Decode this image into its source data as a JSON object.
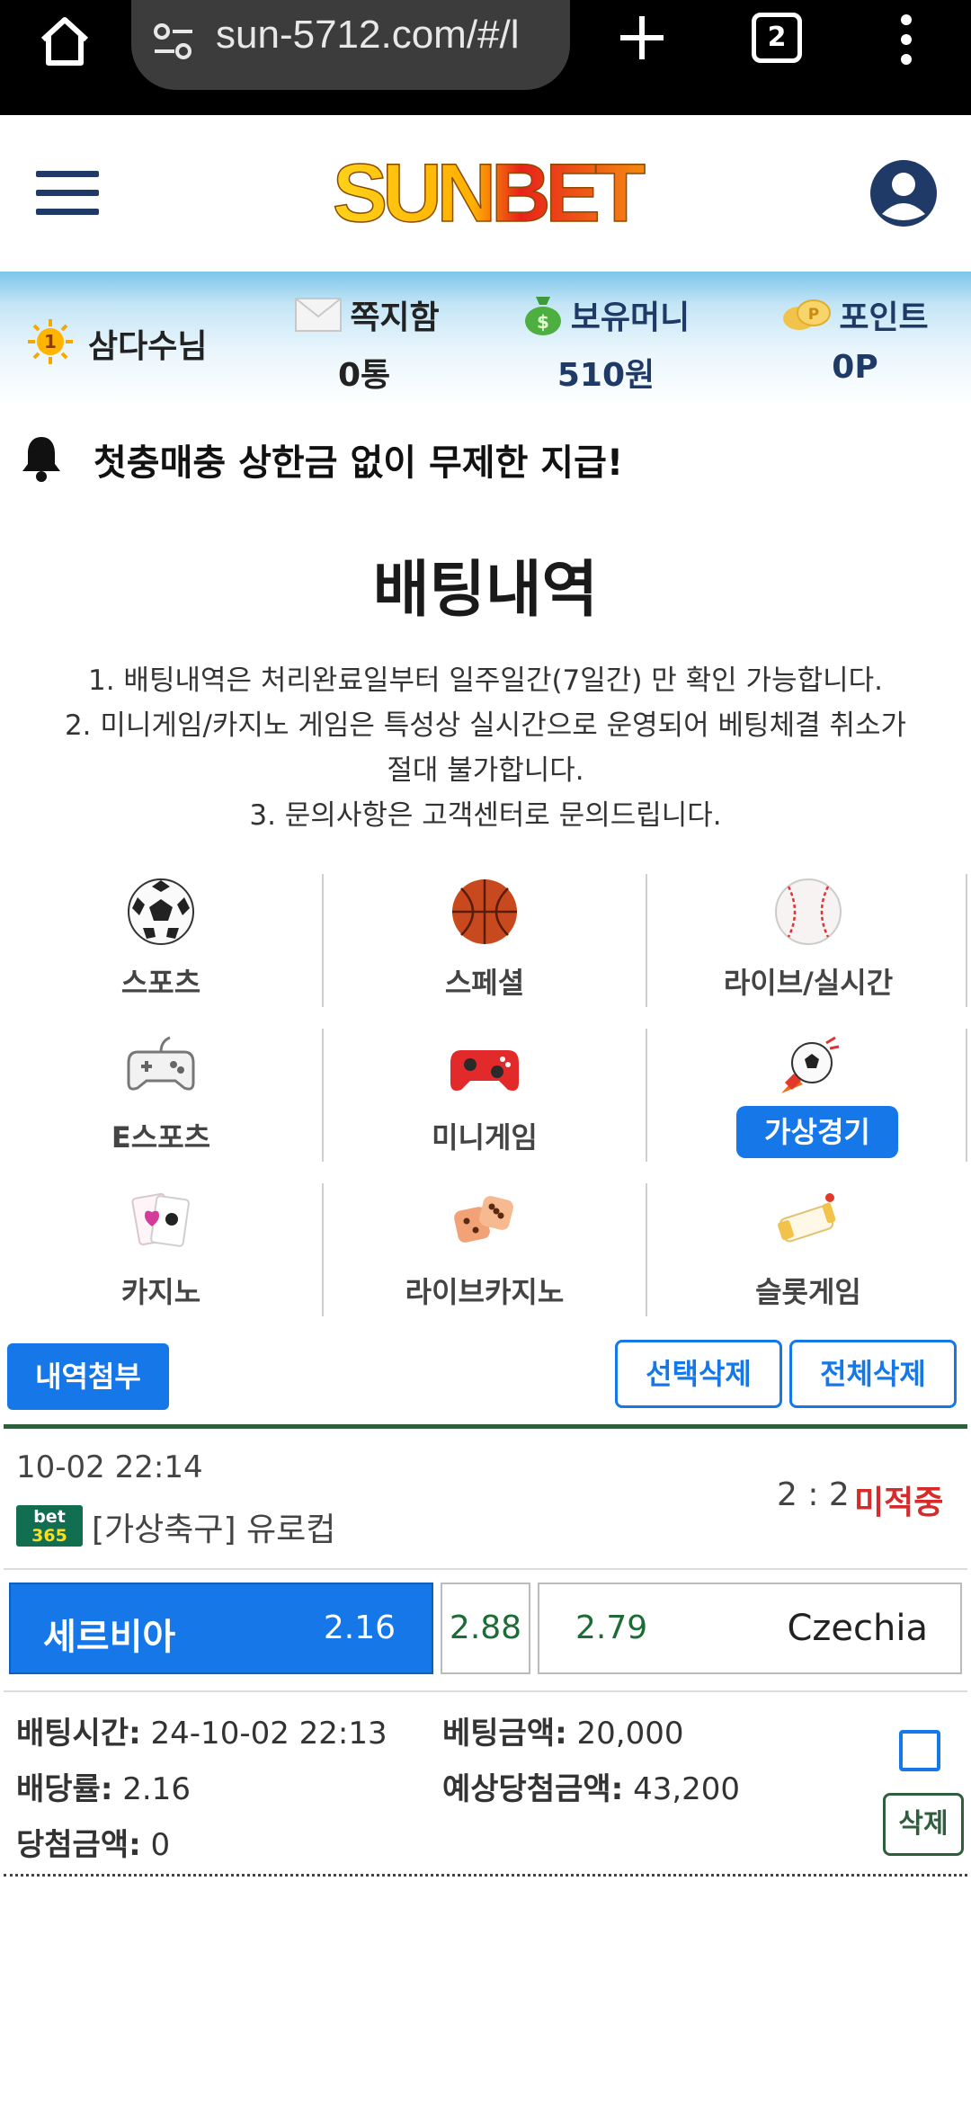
{
  "browser": {
    "url": "sun-5712.com/#/l",
    "tab_count": "2"
  },
  "header": {
    "logo_text": "SUNBET"
  },
  "member": {
    "nickname": "삼다수님",
    "message_label": "쪽지함",
    "message_value": "0통",
    "money_label": "보유머니",
    "money_value": "510원",
    "point_label": "포인트",
    "point_value": "0P"
  },
  "notice": {
    "text": "첫충매충 상한금 없이 무제한 지급!"
  },
  "page": {
    "title": "배팅내역",
    "rules": [
      "1. 배팅내역은 처리완료일부터 일주일간(7일간) 만 확인 가능합니다.",
      "2. 미니게임/카지노 게임은 특성상 실시간으로 운영되어 베팅체결 취소가",
      "절대 불가합니다.",
      "3. 문의사항은 고객센터로 문의드립니다."
    ]
  },
  "categories": [
    {
      "label": "스포츠",
      "icon": "soccer-ball-icon",
      "active": false
    },
    {
      "label": "스페셜",
      "icon": "basketball-icon",
      "active": false
    },
    {
      "label": "라이브/실시간",
      "icon": "baseball-icon",
      "active": false
    },
    {
      "label": "E스포츠",
      "icon": "gamepad-icon",
      "active": false
    },
    {
      "label": "미니게임",
      "icon": "red-controller-icon",
      "active": false
    },
    {
      "label": "가상경기",
      "icon": "rocket-ball-icon",
      "active": true
    },
    {
      "label": "카지노",
      "icon": "cards-icon",
      "active": false
    },
    {
      "label": "라이브카지노",
      "icon": "dice-icon",
      "active": false
    },
    {
      "label": "슬롯게임",
      "icon": "slot-reel-icon",
      "active": false
    }
  ],
  "actions": {
    "attach": "내역첨부",
    "delete_selected": "선택삭제",
    "delete_all": "전체삭제"
  },
  "bet": {
    "datetime": "10-02 22:14",
    "provider_top": "bet",
    "provider_bottom": "365",
    "league": "[가상축구] 유로컵",
    "score": "2 : 2",
    "result": "미적중",
    "home_team": "세르비아",
    "home_odd": "2.16",
    "draw_odd": "2.88",
    "away_odd": "2.79",
    "away_team": "Czechia",
    "bet_time_label": "배팅시간:",
    "bet_time": " 24-10-02 22:13",
    "bet_amount_label": "베팅금액:",
    "bet_amount": " 20,000",
    "odds_label": "배당률:",
    "odds": " 2.16",
    "expected_label": "예상당첨금액:",
    "expected": " 43,200",
    "win_label": "당첨금액:",
    "win": " 0",
    "delete": "삭제"
  },
  "colors": {
    "accent": "#1577e8",
    "result_lost": "#d62b2b",
    "divider_green": "#2e5e3c",
    "navy": "#1f3a66"
  }
}
